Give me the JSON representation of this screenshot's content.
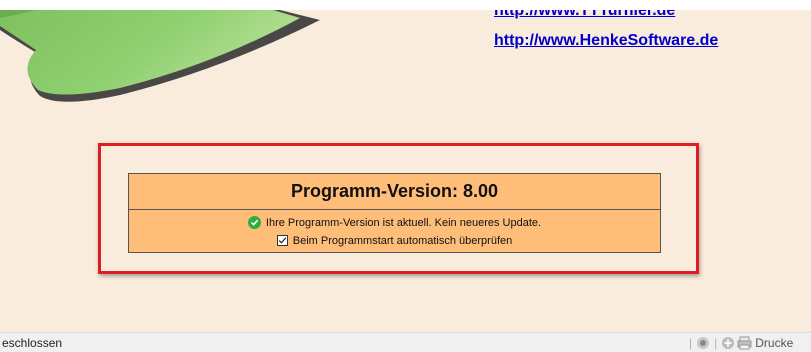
{
  "links": {
    "tt_turnier": "http://www.TTTurnier.de",
    "henke_software": "http://www.HenkeSoftware.de"
  },
  "version_panel": {
    "title": "Programm-Version: 8.00",
    "status_message": "Ihre Programm-Version ist aktuell. Kein neueres Update.",
    "auto_check_label": "Beim Programmstart automatisch überprüfen",
    "auto_check_checked": true
  },
  "statusbar": {
    "left_text": "eschlossen",
    "print_label": "Drucke"
  },
  "colors": {
    "background": "#f9ecdc",
    "panel": "#ffbd7a",
    "highlight_border": "#e11b22",
    "link": "#0000cc",
    "ok_green": "#2eae3d"
  },
  "icons": [
    "logo-leaf",
    "check-circle-icon",
    "checkbox-checked-icon",
    "toolbar-icon",
    "add-icon",
    "printer-icon"
  ]
}
